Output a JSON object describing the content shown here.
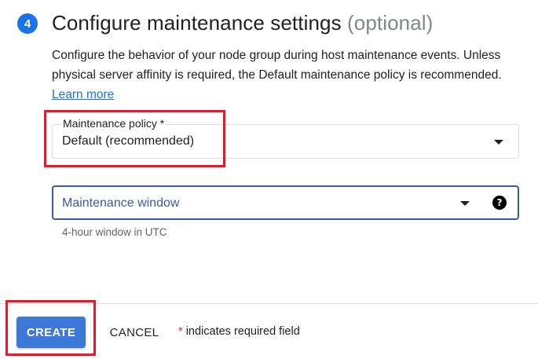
{
  "step": {
    "number": "4",
    "title": "Configure maintenance settings",
    "title_suffix": "(optional)",
    "description": "Configure the behavior of your node group during host maintenance events. Unless physical server affinity is required, the Default maintenance policy is recommended.",
    "learn_more": "Learn more"
  },
  "maintenance_policy": {
    "label": "Maintenance policy *",
    "value": "Default (recommended)",
    "caret_icon": "arrow-drop-down-icon"
  },
  "maintenance_window": {
    "placeholder": "Maintenance window",
    "hint": "4-hour window in UTC",
    "caret_icon": "arrow-drop-down-icon",
    "help_icon": "help-icon",
    "help_glyph": "?"
  },
  "footer": {
    "create_label": "CREATE",
    "cancel_label": "CANCEL",
    "required_star": "*",
    "required_text": "indicates required field"
  },
  "colors": {
    "accent": "#1a73e8",
    "button": "#3c78d8",
    "highlight": "#e8192c",
    "focus_border": "#3c5aa6"
  }
}
